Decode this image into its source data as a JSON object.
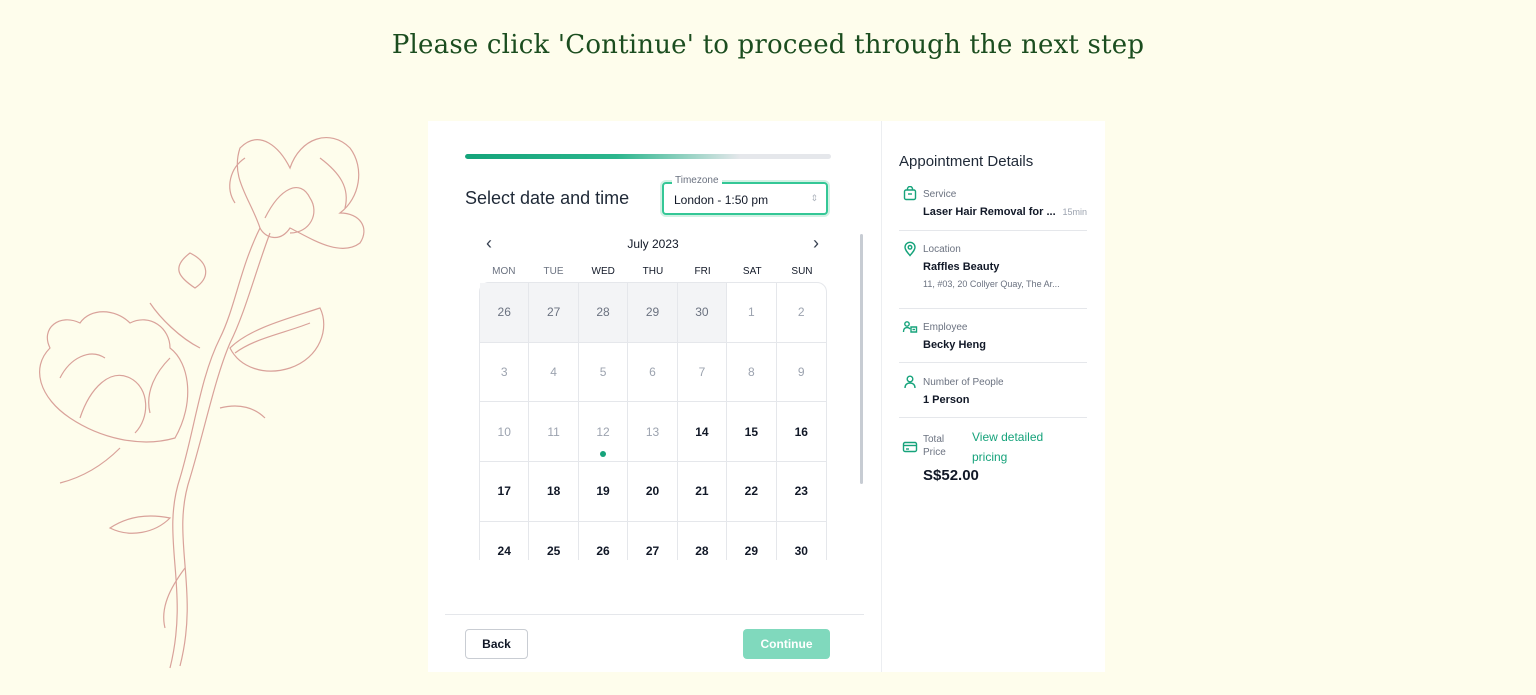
{
  "headline": "Please click 'Continue' to proceed through the next step",
  "booking": {
    "progress": 0.75,
    "section_title": "Select date and time",
    "timezone": {
      "label": "Timezone",
      "value": "London - 1:50 pm"
    },
    "calendar": {
      "month_label": "July 2023",
      "weekdays": [
        "MON",
        "TUE",
        "WED",
        "THU",
        "FRI",
        "SAT",
        "SUN"
      ],
      "days": [
        {
          "d": "26",
          "state": "prev"
        },
        {
          "d": "27",
          "state": "prev"
        },
        {
          "d": "28",
          "state": "prev"
        },
        {
          "d": "29",
          "state": "prev"
        },
        {
          "d": "30",
          "state": "prev"
        },
        {
          "d": "1",
          "state": "past"
        },
        {
          "d": "2",
          "state": "past"
        },
        {
          "d": "3",
          "state": "past"
        },
        {
          "d": "4",
          "state": "past"
        },
        {
          "d": "5",
          "state": "past"
        },
        {
          "d": "6",
          "state": "past"
        },
        {
          "d": "7",
          "state": "past"
        },
        {
          "d": "8",
          "state": "past"
        },
        {
          "d": "9",
          "state": "past"
        },
        {
          "d": "10",
          "state": "past"
        },
        {
          "d": "11",
          "state": "past"
        },
        {
          "d": "12",
          "state": "today"
        },
        {
          "d": "13",
          "state": "past"
        },
        {
          "d": "14",
          "state": "avail"
        },
        {
          "d": "15",
          "state": "avail"
        },
        {
          "d": "16",
          "state": "avail"
        },
        {
          "d": "17",
          "state": "avail"
        },
        {
          "d": "18",
          "state": "avail"
        },
        {
          "d": "19",
          "state": "avail"
        },
        {
          "d": "20",
          "state": "avail"
        },
        {
          "d": "21",
          "state": "avail"
        },
        {
          "d": "22",
          "state": "avail"
        },
        {
          "d": "23",
          "state": "avail"
        },
        {
          "d": "24",
          "state": "avail"
        },
        {
          "d": "25",
          "state": "avail"
        },
        {
          "d": "26",
          "state": "avail"
        },
        {
          "d": "27",
          "state": "avail"
        },
        {
          "d": "28",
          "state": "avail"
        },
        {
          "d": "29",
          "state": "avail"
        },
        {
          "d": "30",
          "state": "avail"
        }
      ]
    },
    "back_label": "Back",
    "continue_label": "Continue"
  },
  "details": {
    "title": "Appointment Details",
    "service": {
      "label": "Service",
      "value": "Laser Hair Removal for ...",
      "duration": "15min"
    },
    "location": {
      "label": "Location",
      "value": "Raffles Beauty",
      "address": "11, #03, 20 Collyer Quay, The Ar..."
    },
    "employee": {
      "label": "Employee",
      "value": "Becky Heng"
    },
    "people": {
      "label": "Number of People",
      "value": "1 Person"
    },
    "price": {
      "label": "Total Price",
      "link": "View detailed pricing",
      "value": "S$52.00"
    }
  },
  "colors": {
    "accent": "#16a37b",
    "background": "#fefdec",
    "headline": "#1b4d1f",
    "flower_line": "#d9a29a"
  },
  "icons": [
    "chevron-left-icon",
    "chevron-right-icon",
    "calendar-bag-icon",
    "location-pin-icon",
    "employee-icon",
    "person-icon",
    "credit-card-icon",
    "selector-icon"
  ]
}
